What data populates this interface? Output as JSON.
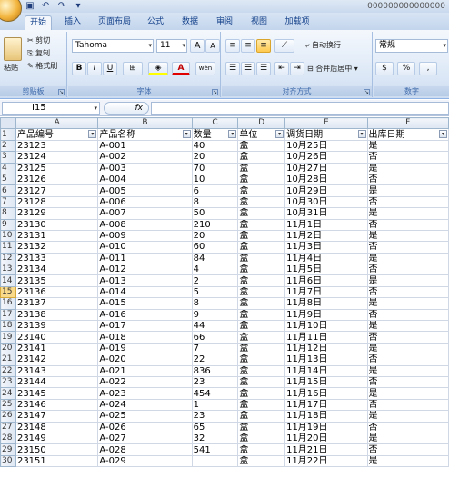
{
  "titlebar": {
    "title": "000000000000000",
    "undo_icon": "undo-icon",
    "redo_icon": "redo-icon",
    "save_icon": "save-icon"
  },
  "tabs": [
    "开始",
    "插入",
    "页面布局",
    "公式",
    "数据",
    "审阅",
    "视图",
    "加载项"
  ],
  "ribbon": {
    "clipboard": {
      "paste": "粘贴",
      "cut": "剪切",
      "copy": "复制",
      "format_painter": "格式刷",
      "label": "剪贴板"
    },
    "font": {
      "font_name": "Tahoma",
      "font_size": "11",
      "grow": "A",
      "shrink": "A",
      "bold": "B",
      "italic": "I",
      "underline": "U",
      "color_letter": "A",
      "phonetic": "wén",
      "label": "字体"
    },
    "alignment": {
      "wrap": "自动换行",
      "merge": "合并后居中",
      "label": "对齐方式"
    },
    "number": {
      "format": "常规",
      "currency": "$",
      "percent": "%",
      "comma": ",",
      "label": "数字"
    }
  },
  "formula_bar": {
    "name_box": "I15",
    "fx": "fx",
    "content": ""
  },
  "columns": [
    "A",
    "B",
    "C",
    "D",
    "E",
    "F"
  ],
  "headers": [
    "产品编号",
    "产品名称",
    "数量",
    "单位",
    "调货日期",
    "出库日期"
  ],
  "selected_row": "15",
  "rows": [
    {
      "n": "2",
      "cells": [
        "23123",
        "A-001",
        "40",
        "盒",
        "10月25日",
        "是"
      ]
    },
    {
      "n": "3",
      "cells": [
        "23124",
        "A-002",
        "20",
        "盒",
        "10月26日",
        "否"
      ]
    },
    {
      "n": "4",
      "cells": [
        "23125",
        "A-003",
        "70",
        "盒",
        "10月27日",
        "是"
      ]
    },
    {
      "n": "5",
      "cells": [
        "23126",
        "A-004",
        "10",
        "盒",
        "10月28日",
        "否"
      ]
    },
    {
      "n": "6",
      "cells": [
        "23127",
        "A-005",
        "6",
        "盒",
        "10月29日",
        "是"
      ]
    },
    {
      "n": "7",
      "cells": [
        "23128",
        "A-006",
        "8",
        "盒",
        "10月30日",
        "否"
      ]
    },
    {
      "n": "8",
      "cells": [
        "23129",
        "A-007",
        "50",
        "盒",
        "10月31日",
        "是"
      ]
    },
    {
      "n": "9",
      "cells": [
        "23130",
        "A-008",
        "210",
        "盒",
        "11月1日",
        "否"
      ]
    },
    {
      "n": "10",
      "cells": [
        "23131",
        "A-009",
        "20",
        "盒",
        "11月2日",
        "是"
      ]
    },
    {
      "n": "11",
      "cells": [
        "23132",
        "A-010",
        "60",
        "盒",
        "11月3日",
        "否"
      ]
    },
    {
      "n": "12",
      "cells": [
        "23133",
        "A-011",
        "84",
        "盒",
        "11月4日",
        "是"
      ]
    },
    {
      "n": "13",
      "cells": [
        "23134",
        "A-012",
        "4",
        "盒",
        "11月5日",
        "否"
      ]
    },
    {
      "n": "14",
      "cells": [
        "23135",
        "A-013",
        "2",
        "盒",
        "11月6日",
        "是"
      ]
    },
    {
      "n": "15",
      "cells": [
        "23136",
        "A-014",
        "5",
        "盒",
        "11月7日",
        "否"
      ]
    },
    {
      "n": "16",
      "cells": [
        "23137",
        "A-015",
        "8",
        "盒",
        "11月8日",
        "是"
      ]
    },
    {
      "n": "17",
      "cells": [
        "23138",
        "A-016",
        "9",
        "盒",
        "11月9日",
        "否"
      ]
    },
    {
      "n": "18",
      "cells": [
        "23139",
        "A-017",
        "44",
        "盒",
        "11月10日",
        "是"
      ]
    },
    {
      "n": "19",
      "cells": [
        "23140",
        "A-018",
        "66",
        "盒",
        "11月11日",
        "否"
      ]
    },
    {
      "n": "20",
      "cells": [
        "23141",
        "A-019",
        "7",
        "盒",
        "11月12日",
        "是"
      ]
    },
    {
      "n": "21",
      "cells": [
        "23142",
        "A-020",
        "22",
        "盒",
        "11月13日",
        "否"
      ]
    },
    {
      "n": "22",
      "cells": [
        "23143",
        "A-021",
        "836",
        "盒",
        "11月14日",
        "是"
      ]
    },
    {
      "n": "23",
      "cells": [
        "23144",
        "A-022",
        "23",
        "盒",
        "11月15日",
        "否"
      ]
    },
    {
      "n": "24",
      "cells": [
        "23145",
        "A-023",
        "454",
        "盒",
        "11月16日",
        "是"
      ]
    },
    {
      "n": "25",
      "cells": [
        "23146",
        "A-024",
        "1",
        "盒",
        "11月17日",
        "否"
      ]
    },
    {
      "n": "26",
      "cells": [
        "23147",
        "A-025",
        "23",
        "盒",
        "11月18日",
        "是"
      ]
    },
    {
      "n": "27",
      "cells": [
        "23148",
        "A-026",
        "65",
        "盒",
        "11月19日",
        "否"
      ]
    },
    {
      "n": "28",
      "cells": [
        "23149",
        "A-027",
        "32",
        "盒",
        "11月20日",
        "是"
      ]
    },
    {
      "n": "29",
      "cells": [
        "23150",
        "A-028",
        "541",
        "盒",
        "11月21日",
        "否"
      ]
    },
    {
      "n": "30",
      "cells": [
        "23151",
        "A-029",
        "",
        "盒",
        "11月22日",
        "是"
      ]
    }
  ]
}
